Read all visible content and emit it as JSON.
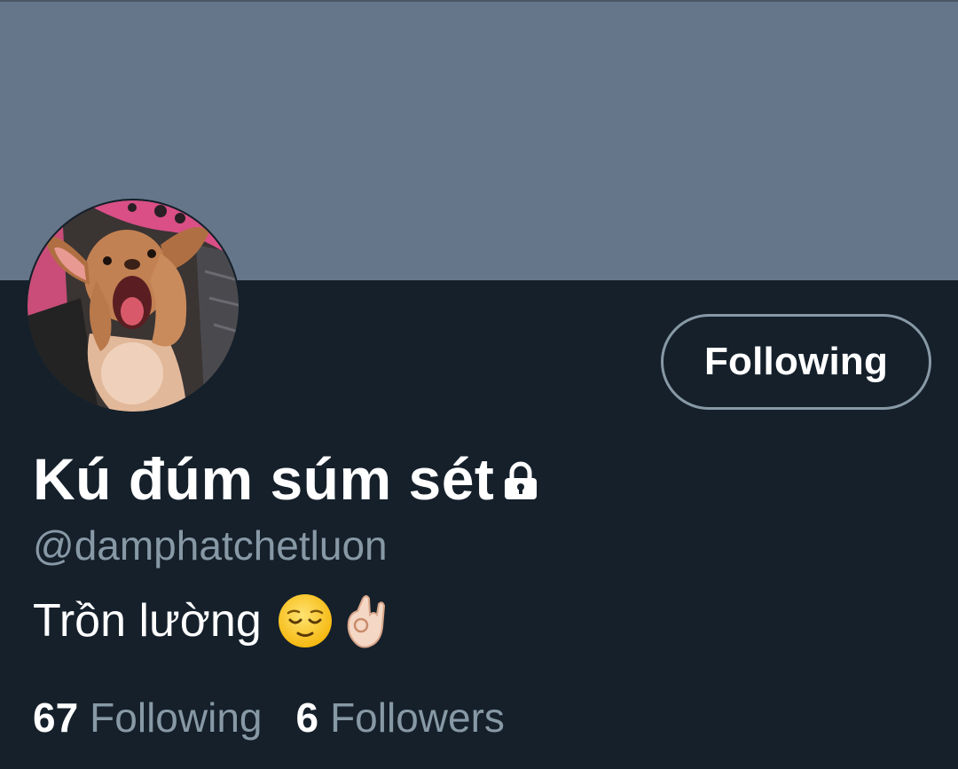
{
  "profile": {
    "display_name": "Kú đúm súm sét",
    "handle": "@damphatchetluon",
    "bio_text": "Trồn lường",
    "bio_emojis": [
      "relieved-face-emoji",
      "ok-hand-emoji"
    ],
    "locked_icon": "lock-icon",
    "avatar_icon": "dog-photo"
  },
  "actions": {
    "follow_button_label": "Following"
  },
  "stats": {
    "following_count": "67",
    "following_label": "Following",
    "followers_count": "6",
    "followers_label": "Followers"
  },
  "colors": {
    "background": "#15202b",
    "banner": "#66768a",
    "secondary_text": "#8899a6",
    "primary_text": "#ffffff"
  }
}
